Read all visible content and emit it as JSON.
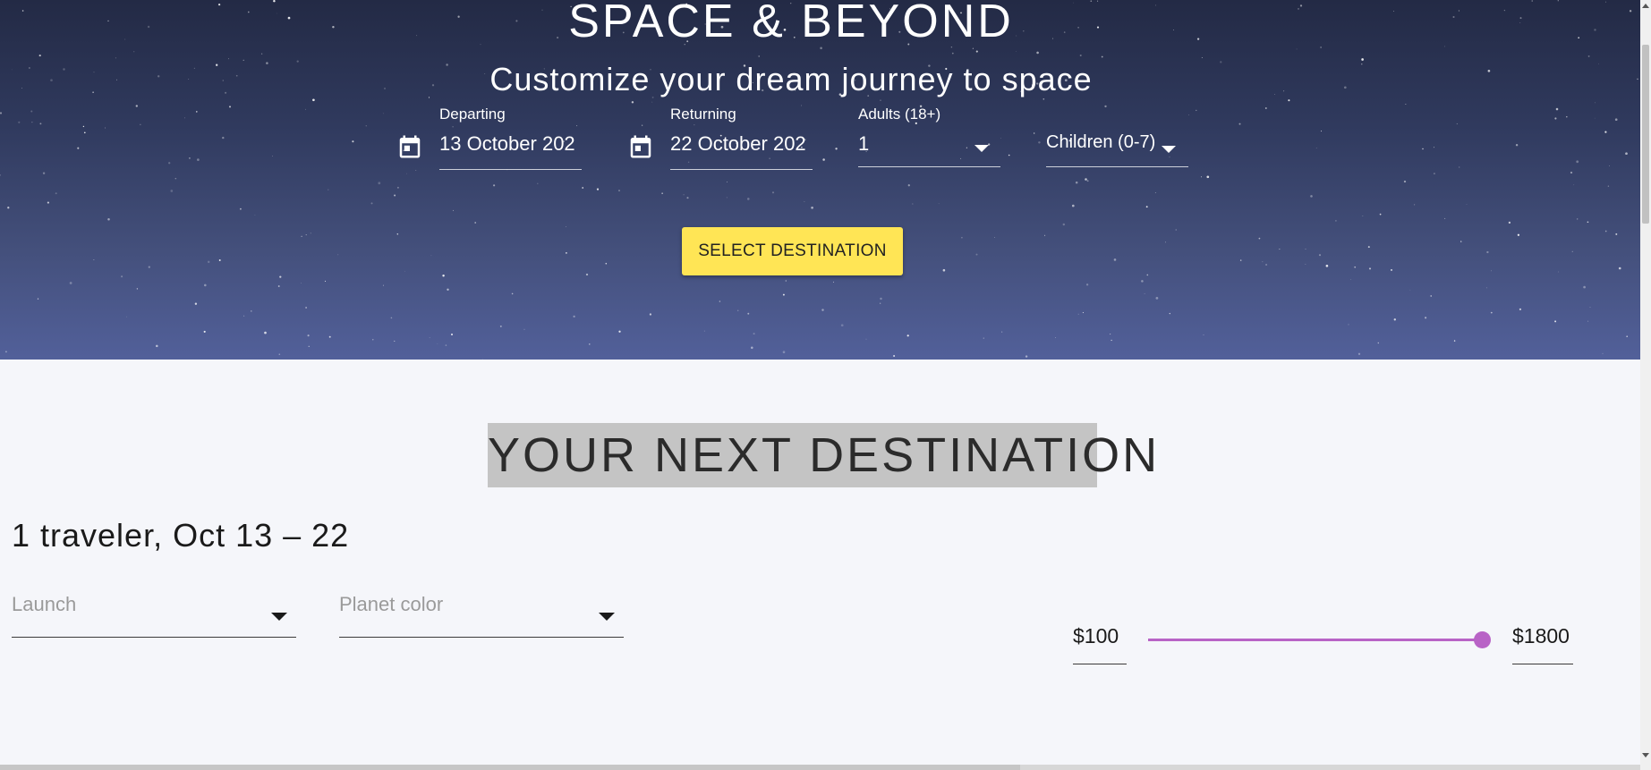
{
  "hero": {
    "title": "SPACE & BEYOND",
    "subtitle": "Customize your dream journey to space",
    "departing": {
      "label": "Departing",
      "value": "13 October 202"
    },
    "returning": {
      "label": "Returning",
      "value": "22 October 202"
    },
    "adults": {
      "label": "Adults (18+)",
      "value": "1"
    },
    "children": {
      "placeholder": "Children (0-7)"
    },
    "cta_label": "SELECT DESTINATION"
  },
  "main": {
    "section_title": "YOUR NEXT DESTINATION",
    "trip_summary": "1 traveler, Oct 13 – 22",
    "launch_placeholder": "Launch",
    "planet_color_placeholder": "Planet color",
    "price_min": "$100",
    "price_max": "$1800",
    "price_slider_fill_fraction": 1.0
  },
  "colors": {
    "accent_yellow": "#ffe555",
    "slider_purple": "#b863c6",
    "hero_gradient_top": "#232a45",
    "hero_gradient_bottom": "#52609a",
    "page_background": "#f5f6fa"
  },
  "icons": {
    "departing": "calendar-icon",
    "returning": "calendar-icon",
    "dropdown": "chevron-down-icon"
  }
}
